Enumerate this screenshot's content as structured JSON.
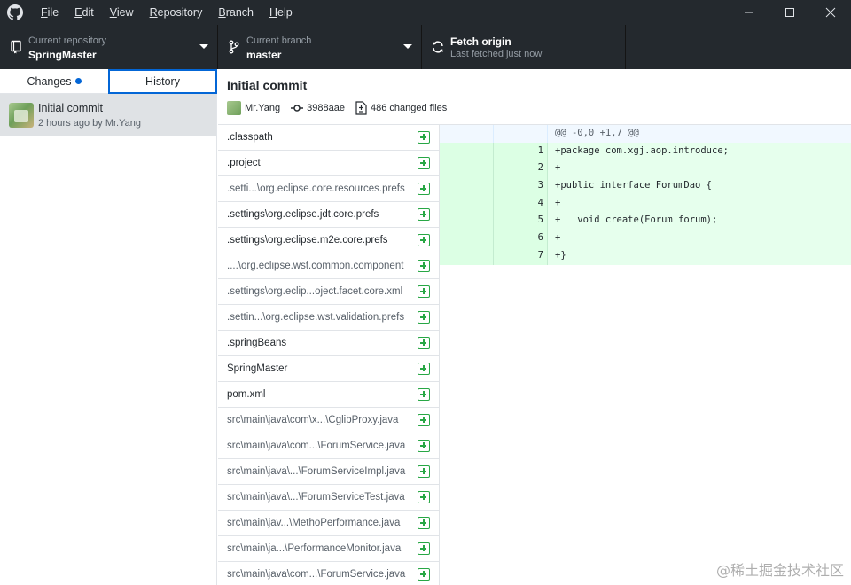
{
  "menu": [
    "File",
    "Edit",
    "View",
    "Repository",
    "Branch",
    "Help"
  ],
  "toolbar": {
    "repo_label": "Current repository",
    "repo_value": "SpringMaster",
    "branch_label": "Current branch",
    "branch_value": "master",
    "fetch_label": "Fetch origin",
    "fetch_sub": "Last fetched just now"
  },
  "tabs": {
    "changes": "Changes",
    "history": "History"
  },
  "commit": {
    "title": "Initial commit",
    "meta": "2 hours ago by Mr.Yang",
    "author": "Mr.Yang",
    "sha": "3988aae",
    "changed_files": "486 changed files"
  },
  "files": [
    ".classpath",
    ".project",
    ".setti...\\org.eclipse.core.resources.prefs",
    ".settings\\org.eclipse.jdt.core.prefs",
    ".settings\\org.eclipse.m2e.core.prefs",
    "....\\org.eclipse.wst.common.component",
    ".settings\\org.eclip...oject.facet.core.xml",
    ".settin...\\org.eclipse.wst.validation.prefs",
    ".springBeans",
    "SpringMaster",
    "pom.xml",
    "src\\main\\java\\com\\x...\\CglibProxy.java",
    "src\\main\\java\\com...\\ForumService.java",
    "src\\main\\java\\...\\ForumServiceImpl.java",
    "src\\main\\java\\...\\ForumServiceTest.java",
    "src\\main\\jav...\\MethoPerformance.java",
    "src\\main\\ja...\\PerformanceMonitor.java",
    "src\\main\\java\\com...\\ForumService.java"
  ],
  "diff": {
    "hunk": "@@ -0,0 +1,7 @@",
    "lines": [
      {
        "num": "1",
        "code": "+package com.xgj.aop.introduce;"
      },
      {
        "num": "2",
        "code": "+"
      },
      {
        "num": "3",
        "code": "+public interface ForumDao {"
      },
      {
        "num": "4",
        "code": "+"
      },
      {
        "num": "5",
        "code": "+   void create(Forum forum);"
      },
      {
        "num": "6",
        "code": "+"
      },
      {
        "num": "7",
        "code": "+}"
      }
    ]
  },
  "watermark": "@稀土掘金技术社区"
}
